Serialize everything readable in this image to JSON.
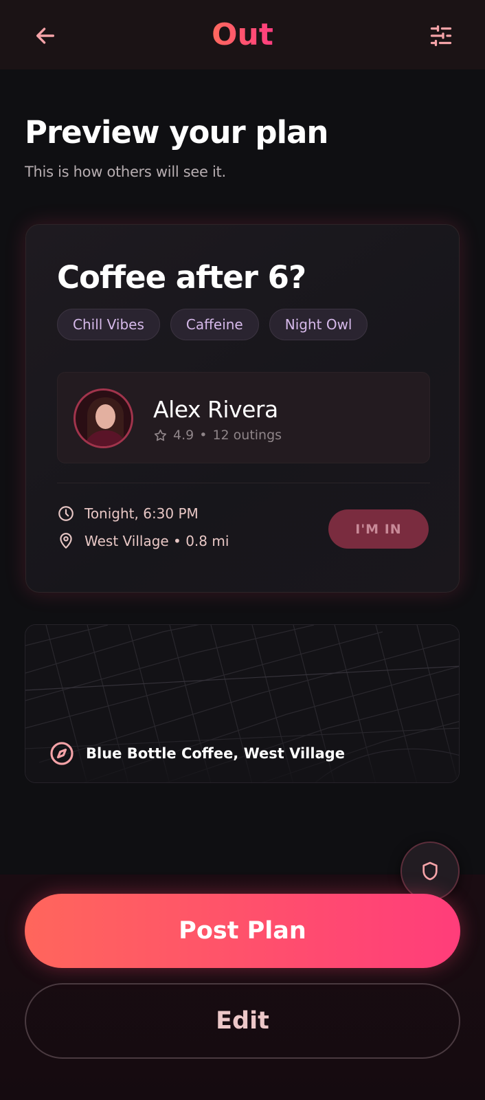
{
  "app": {
    "brand": "Out"
  },
  "header": {
    "back_icon": "arrow-left-icon",
    "filters_icon": "sliders-icon"
  },
  "page": {
    "title": "Preview your plan",
    "subtitle": "This is how others will see it."
  },
  "plan": {
    "title": "Coffee after 6?",
    "tags": [
      "Chill Vibes",
      "Caffeine",
      "Night Owl"
    ],
    "host": {
      "name": "Alex Rivera",
      "rating": "4.9",
      "outings": "12 outings"
    },
    "time": "Tonight, 6:30 PM",
    "location": "West Village • 0.8 mi",
    "join_label": "I'M IN"
  },
  "map": {
    "place": "Blue Bottle Coffee, West Village"
  },
  "actions": {
    "post_label": "Post Plan",
    "edit_label": "Edit"
  },
  "colors": {
    "accent_start": "#ff665c",
    "accent_end": "#ff3d7a",
    "background": "#0f0f12",
    "tag_text": "#d6b9ea"
  }
}
